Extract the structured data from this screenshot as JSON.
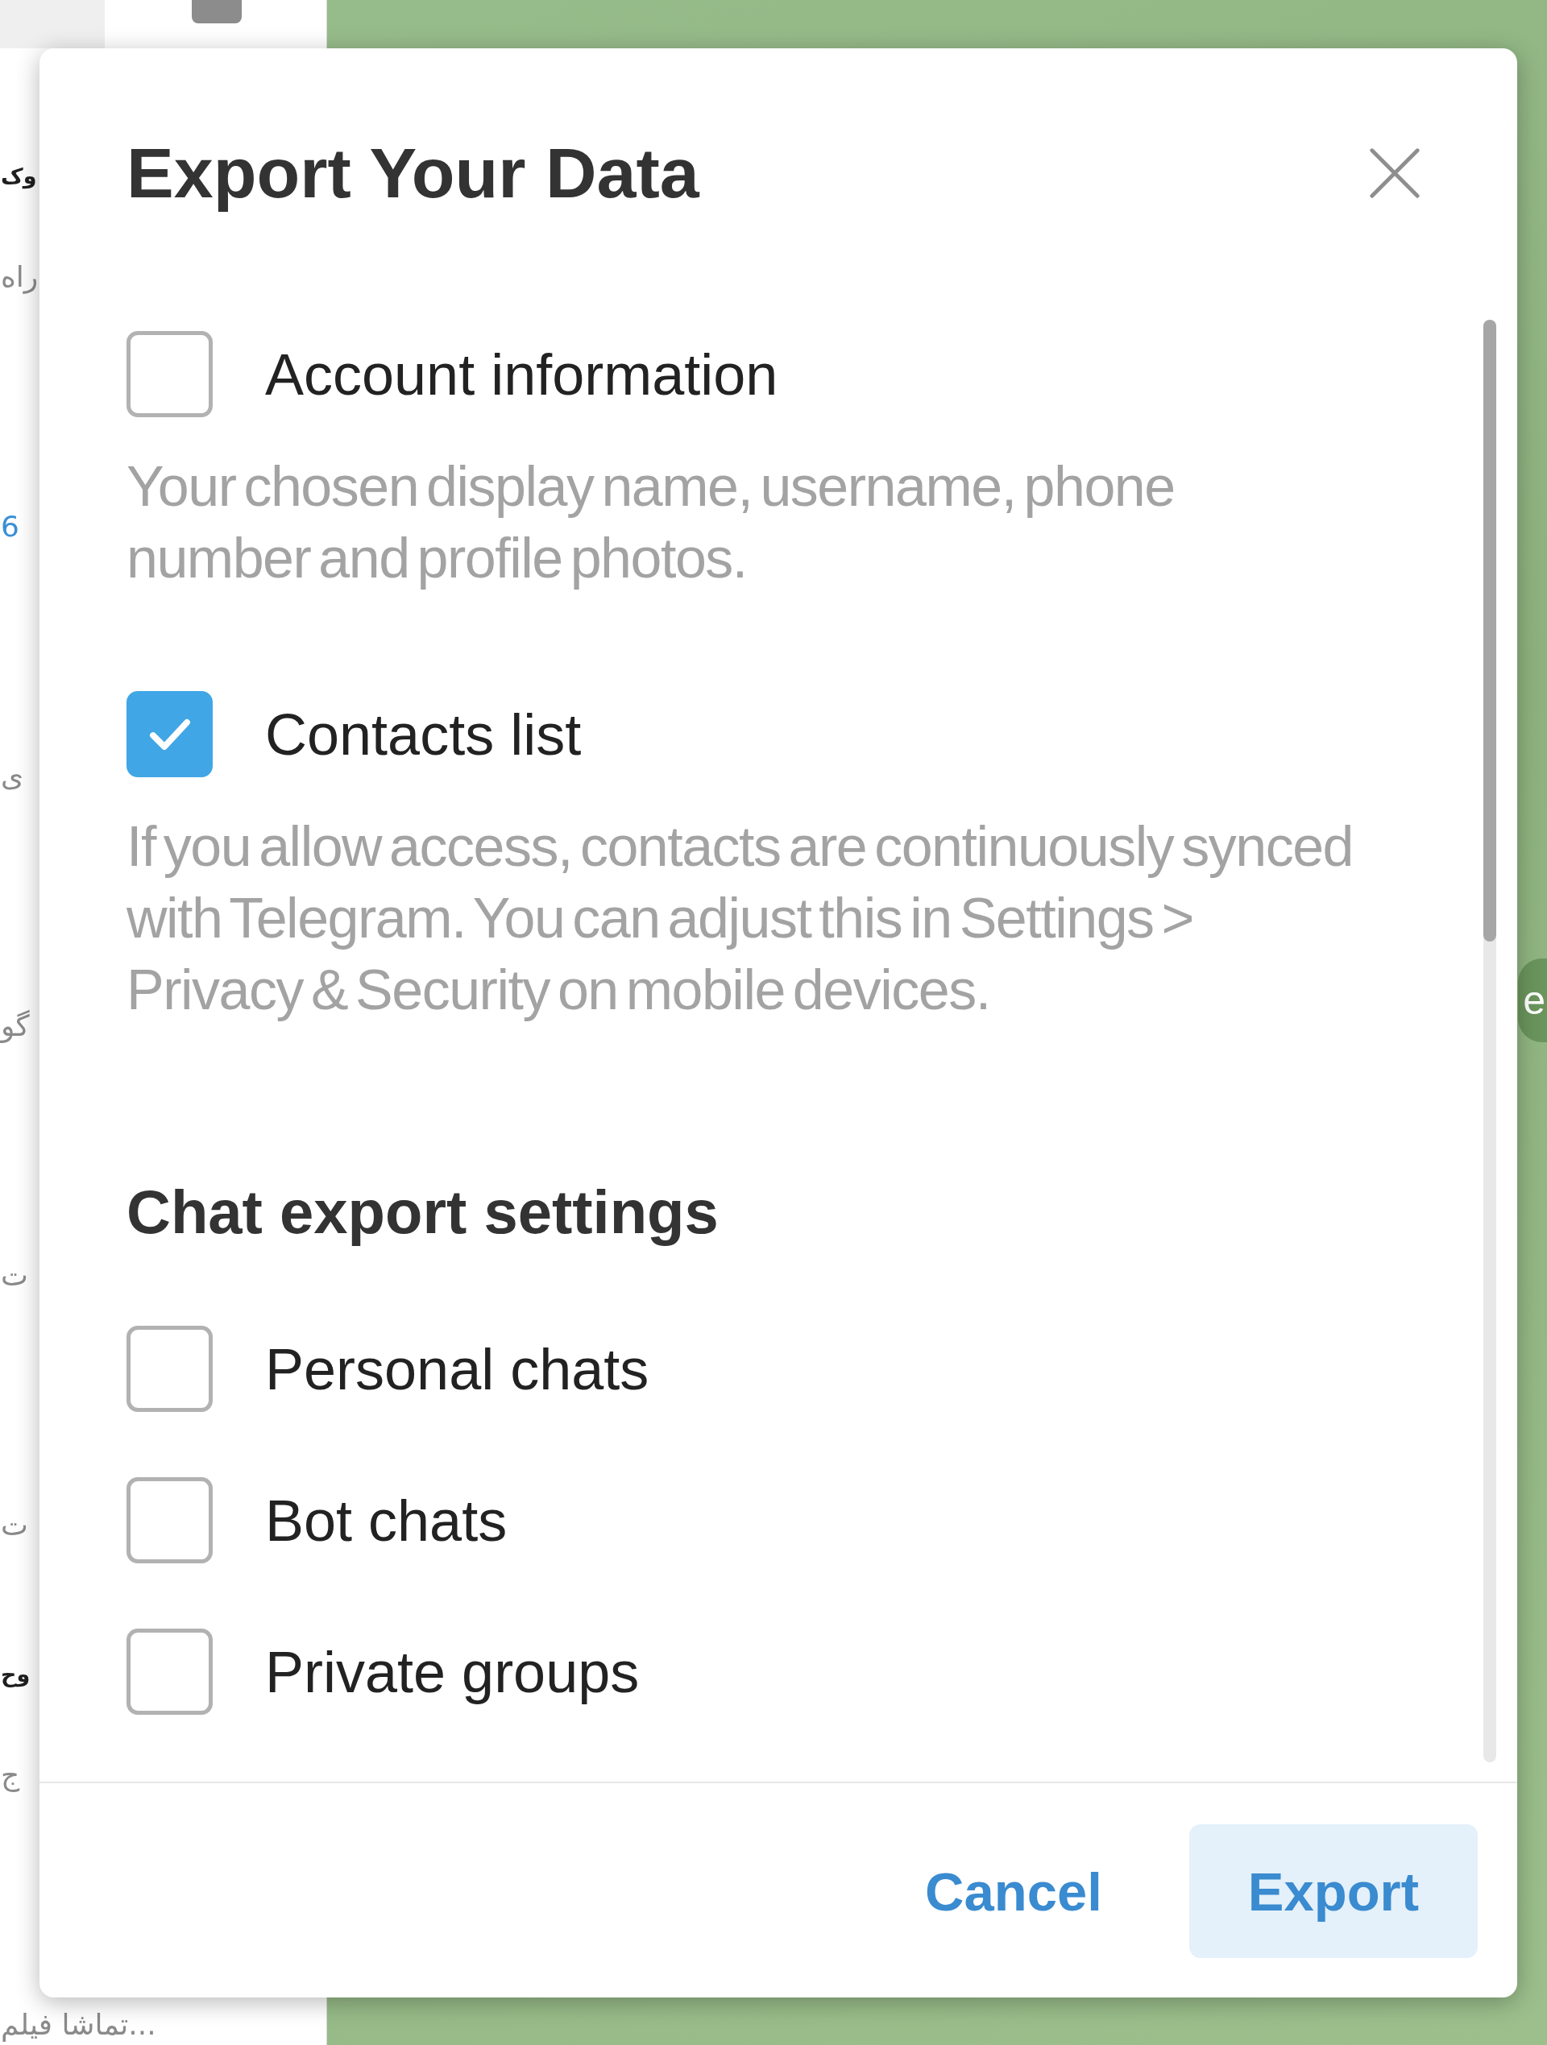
{
  "chat_list": [
    {
      "name": "وک",
      "preview": "راه",
      "link": false
    },
    {
      "preview": "6",
      "link": true
    },
    {
      "preview": "ی",
      "link": false
    },
    {
      "preview": "گو",
      "link": false
    },
    {
      "preview": "ت",
      "link": false
    },
    {
      "preview": "ت",
      "link": false
    },
    {
      "name": "وح",
      "preview": "ج",
      "link": false
    },
    {
      "preview": "تماشا فیلم...",
      "link": false
    }
  ],
  "chat_area": {
    "pill_text": "e"
  },
  "dialog": {
    "title": "Export Your Data",
    "options": [
      {
        "label": "Account information",
        "description": "Your chosen display name, username, phone number and profile photos.",
        "checked": false
      },
      {
        "label": "Contacts list",
        "description": "If you allow access, contacts are continuously synced with Telegram. You can adjust this in Settings > Privacy & Security on mobile devices.",
        "checked": true
      }
    ],
    "chat_section": {
      "heading": "Chat export settings",
      "options": [
        {
          "label": "Personal chats",
          "checked": false
        },
        {
          "label": "Bot chats",
          "checked": false
        },
        {
          "label": "Private groups",
          "checked": false
        }
      ]
    },
    "buttons": [
      {
        "label": "Cancel",
        "highlighted": false
      },
      {
        "label": "Export",
        "highlighted": true
      }
    ]
  }
}
